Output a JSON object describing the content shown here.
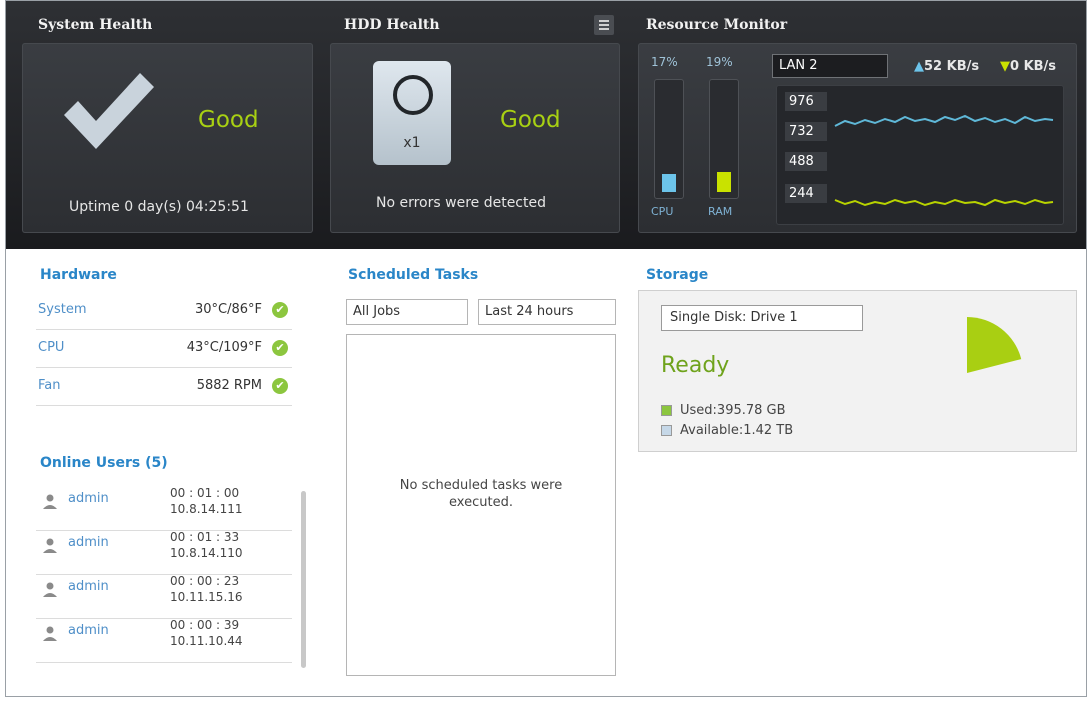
{
  "system_health": {
    "title": "System Health",
    "status": "Good",
    "uptime": "Uptime 0 day(s) 04:25:51"
  },
  "hdd_health": {
    "title": "HDD Health",
    "disk_label": "x1",
    "status": "Good",
    "message": "No errors were detected"
  },
  "resource_monitor": {
    "title": "Resource Monitor",
    "cpu": {
      "label": "CPU",
      "percent_text": "17%",
      "level": 0.17
    },
    "ram": {
      "label": "RAM",
      "percent_text": "19%",
      "level": 0.19
    },
    "lan_select": "LAN 2",
    "upload_speed": "52 KB/s",
    "download_speed": "0 KB/s",
    "y_ticks": [
      "976",
      "732",
      "488",
      "244"
    ],
    "colors": {
      "cpu": "#6cc4ea",
      "ram": "#c9e200",
      "upload_line": "#5fb8d8",
      "download_line": "#b9d400"
    }
  },
  "hardware": {
    "title": "Hardware",
    "items": [
      {
        "name": "System",
        "value": "30°C/86°F"
      },
      {
        "name": "CPU",
        "value": "43°C/109°F"
      },
      {
        "name": "Fan",
        "value": "5882 RPM"
      }
    ]
  },
  "online_users": {
    "title": "Online Users (5)",
    "users": [
      {
        "name": "admin",
        "time": "00 : 01 : 00",
        "ip": "10.8.14.111"
      },
      {
        "name": "admin",
        "time": "00 : 01 : 33",
        "ip": "10.8.14.110"
      },
      {
        "name": "admin",
        "time": "00 : 00 : 23",
        "ip": "10.11.15.16"
      },
      {
        "name": "admin",
        "time": "00 : 00 : 39",
        "ip": "10.11.10.44"
      }
    ]
  },
  "scheduled_tasks": {
    "title": "Scheduled Tasks",
    "job_filter": "All Jobs",
    "time_filter": "Last 24 hours",
    "empty_line1": "No scheduled tasks were",
    "empty_line2": "executed."
  },
  "storage": {
    "title": "Storage",
    "disk_select": "Single Disk: Drive  1",
    "status": "Ready",
    "used": "Used:395.78 GB",
    "available": "Available:1.42 TB",
    "used_fraction": 0.21,
    "colors": {
      "used": "#8cc63f",
      "available": "#c6d8e8",
      "pie": "#a9cf12"
    }
  }
}
